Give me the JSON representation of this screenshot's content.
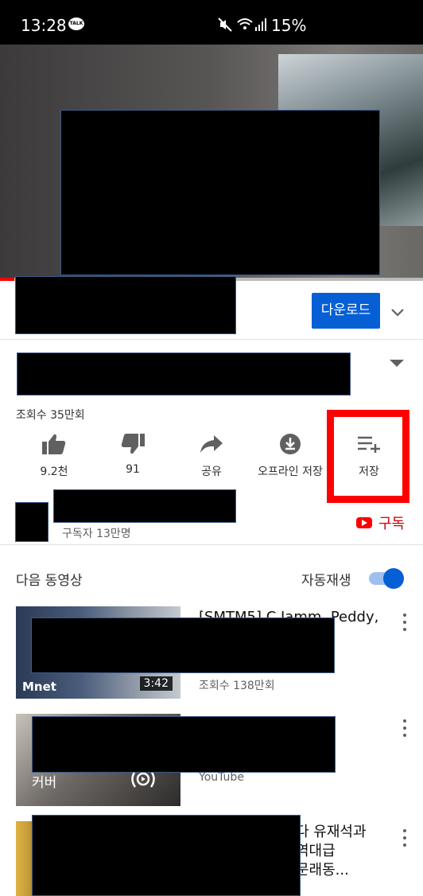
{
  "status_bar": {
    "time": "13:28",
    "chat_icon_label": "TALK",
    "battery": "15%"
  },
  "download": {
    "label": "다운로드"
  },
  "video": {
    "views": "조회수 35만회"
  },
  "actions": [
    {
      "label": "9.2천",
      "icon": "thumbs-up-icon"
    },
    {
      "label": "91",
      "icon": "thumbs-down-icon"
    },
    {
      "label": "공유",
      "icon": "share-icon"
    },
    {
      "label": "오프라인 저장",
      "icon": "offline-download-icon"
    },
    {
      "label": "저장",
      "icon": "playlist-add-icon"
    }
  ],
  "channel": {
    "subscribers": "구독자 13만명",
    "subscribe_label": "구독"
  },
  "up_next": {
    "label": "다음 동영상",
    "autoplay_label": "자동재생",
    "autoplay_on": true
  },
  "videos": [
    {
      "title": "[SMTM5] C Jamm, Peddy,\n$insa\n...",
      "meta": "조회수 138만회",
      "duration": "3:42",
      "badge": "Mnet"
    },
    {
      "title": "...",
      "meta": "YouTube",
      "thumb_text_left": "커버"
    },
    {
      "title": "다 유재석과\n역대급\n문래동...",
      "meta": ""
    }
  ],
  "colors": {
    "accent_blue": "#065fd4",
    "youtube_red": "#ff0000",
    "highlight": "#ff0000"
  }
}
